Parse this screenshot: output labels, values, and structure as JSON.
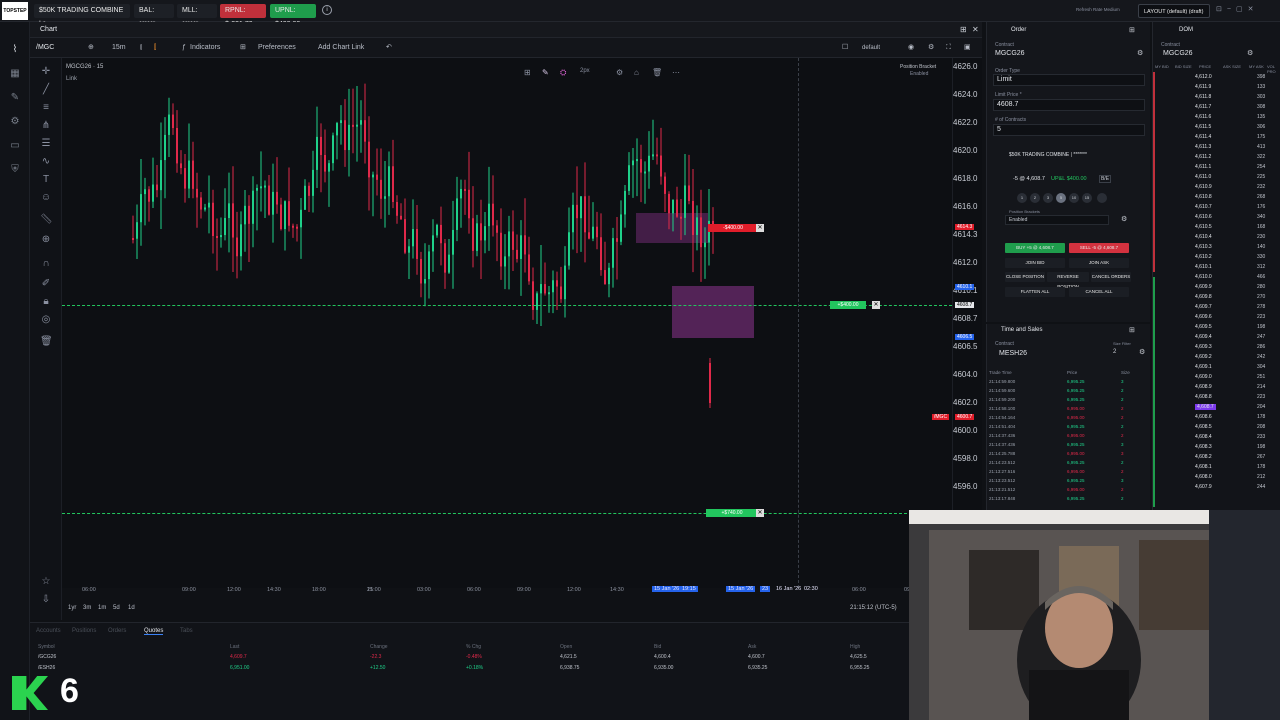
{
  "topbar": {
    "logo": "TOPSTEP",
    "account": "$50K TRADING COMBINE | *...",
    "bal": "BAL: ******",
    "mll": "MLL: ******",
    "rpnl": "RPNL: $-231.70",
    "upnl": "UPNL: $400.00",
    "user": "Refresh Rate Medium",
    "layout": "LAYOUT (default) (draft)"
  },
  "chart_panel": {
    "title": "Chart",
    "symbol": "/MGC",
    "timeframe": "15m",
    "indicators": "Indicators",
    "preferences": "Preferences",
    "add_link": "Add Chart Link",
    "default_label": "default",
    "series_title": "MGCG26 · 15",
    "link_label": "Link",
    "position_bracket": "Position Bracket",
    "position_bracket_state": "Enabled",
    "drawing_size": "2px"
  },
  "price_axis": [
    "4626.0",
    "4624.0",
    "4622.0",
    "4620.0",
    "4618.0",
    "4616.0",
    "4614.3",
    "4612.0",
    "4610.1",
    "4608.7",
    "4606.5",
    "4604.0",
    "4602.0",
    "4600.0",
    "4598.0",
    "4596.0"
  ],
  "price_tags": {
    "stop": "4614.3",
    "last": "4608.7",
    "entry": "4606.5",
    "mgc": "4600.7",
    "mgc_label": "/MGC",
    "upper": "4610.1"
  },
  "orders": {
    "stop_order": "-$400.00",
    "position": "+$400.00",
    "target": "+$740.00"
  },
  "time_axis": [
    "06:00",
    "09:00",
    "12:00",
    "14:30",
    "18:00",
    "21:00",
    "15",
    "03:00",
    "06:00",
    "09:00",
    "12:00",
    "14:30",
    "06:00",
    "09"
  ],
  "time_highlights": [
    "15 Jan '26",
    "19:15",
    "15 Jan '26",
    "23",
    "16 Jan '26",
    "02:30"
  ],
  "periods": [
    "1yr",
    "3m",
    "1m",
    "5d",
    "1d"
  ],
  "clock": "21:15:12 (UTC-5)",
  "quotes": {
    "tabs": [
      "Accounts",
      "Positions",
      "Orders",
      "Quotes",
      "Tabs"
    ],
    "active_tab": "Quotes",
    "headers": [
      "Symbol",
      "Last",
      "Change",
      "% Chg",
      "Open",
      "Bid",
      "Ask",
      "High"
    ],
    "rows": [
      [
        "/GCG26",
        "4,609.7",
        "-22.3",
        "-0.48%",
        "4,621.5",
        "4,600.4",
        "4,600.7",
        "4,625.5"
      ],
      [
        "/ESH26",
        "6,951.00",
        "+12.50",
        "+0.18%",
        "6,938.75",
        "6,935.00",
        "6,935.25",
        "6,955.25"
      ]
    ]
  },
  "order_panel": {
    "title": "Order",
    "contract_label": "Contract",
    "contract": "MGCG26",
    "order_type_label": "Order Type",
    "order_type": "Limit",
    "limit_price_label": "Limit Price *",
    "limit_price": "4608.7",
    "contracts_label": "# of Contracts",
    "contracts": "5",
    "account": "$50K TRADING COMBINE | *******",
    "position": "-5 @ 4,608.7",
    "upnl": "UP&L $400.00",
    "be": "B/E",
    "qty_buttons": [
      "1",
      "2",
      "3",
      "5",
      "10",
      "15"
    ],
    "bracket_label": "Position Brackets",
    "bracket_value": "Enabled",
    "buy": "BUY +5 @ 4,608.7",
    "sell": "SELL -5 @ 4,608.7",
    "join_bid": "JOIN BID",
    "join_ask": "JOIN ASK",
    "close_position": "CLOSE POSITION",
    "reverse_position": "REVERSE POSITION",
    "cancel_orders": "CANCEL ORDERS",
    "flatten_all": "FLATTEN ALL",
    "cancel_all": "CANCEL ALL"
  },
  "tas": {
    "title": "Time and Sales",
    "contract_label": "Contract",
    "contract": "MESH26",
    "size_filter": "2",
    "size_filter_label": "Size Filter",
    "headers": [
      "Trade Time",
      "Price",
      "Size"
    ],
    "rows": [
      [
        "21:14:59.800",
        "6,995.25",
        "3",
        "green"
      ],
      [
        "21:14:59.600",
        "6,995.25",
        "2",
        "green"
      ],
      [
        "21:14:59.200",
        "6,995.25",
        "2",
        "green"
      ],
      [
        "21:14:58.100",
        "6,995.00",
        "2",
        "red"
      ],
      [
        "21:14:54.164",
        "6,995.00",
        "2",
        "red"
      ],
      [
        "21:14:51.404",
        "6,995.25",
        "2",
        "green"
      ],
      [
        "21:14:37.436",
        "6,995.00",
        "2",
        "red"
      ],
      [
        "21:14:37.436",
        "6,995.25",
        "3",
        "green"
      ],
      [
        "21:14:25.788",
        "6,995.00",
        "3",
        "red"
      ],
      [
        "21:14:23.512",
        "6,995.25",
        "2",
        "green"
      ],
      [
        "21:13:27.516",
        "6,995.00",
        "2",
        "red"
      ],
      [
        "21:13:23.512",
        "6,995.25",
        "3",
        "green"
      ],
      [
        "21:13:21.512",
        "6,995.00",
        "2",
        "red"
      ],
      [
        "21:13:17.848",
        "6,995.25",
        "2",
        "green"
      ]
    ]
  },
  "dom": {
    "title": "DOM",
    "contract_label": "Contract",
    "contract": "MGCG26",
    "headers": [
      "MY BID",
      "BID SIZE",
      "PRICE",
      "ASK SIZE",
      "MY ASK",
      "VOL PRO"
    ],
    "rows": [
      [
        "4,612.0",
        "398"
      ],
      [
        "4,611.9",
        "133"
      ],
      [
        "4,611.8",
        "303"
      ],
      [
        "4,611.7",
        "308"
      ],
      [
        "4,611.6",
        "135"
      ],
      [
        "4,611.5",
        "306"
      ],
      [
        "4,611.4",
        "175"
      ],
      [
        "4,611.3",
        "413"
      ],
      [
        "4,611.2",
        "322"
      ],
      [
        "4,611.1",
        "254"
      ],
      [
        "4,611.0",
        "225"
      ],
      [
        "4,610.9",
        "232"
      ],
      [
        "4,610.8",
        "268"
      ],
      [
        "4,610.7",
        "176"
      ],
      [
        "4,610.6",
        "340"
      ],
      [
        "4,610.5",
        "168"
      ],
      [
        "4,610.4",
        "230"
      ],
      [
        "4,610.3",
        "140"
      ],
      [
        "4,610.2",
        "330"
      ],
      [
        "4,610.1",
        "312"
      ],
      [
        "4,610.0",
        "466"
      ],
      [
        "4,609.9",
        "280"
      ],
      [
        "4,609.8",
        "270"
      ],
      [
        "4,609.7",
        "278"
      ],
      [
        "4,609.6",
        "223"
      ],
      [
        "4,609.5",
        "198"
      ],
      [
        "4,609.4",
        "247"
      ],
      [
        "4,609.3",
        "286"
      ],
      [
        "4,609.2",
        "242"
      ],
      [
        "4,609.1",
        "304"
      ],
      [
        "4,609.0",
        "251"
      ],
      [
        "4,608.9",
        "214"
      ],
      [
        "4,608.8",
        "223"
      ],
      [
        "4,608.7",
        "204"
      ],
      [
        "4,608.6",
        "178"
      ],
      [
        "4,608.5",
        "208"
      ],
      [
        "4,608.4",
        "233"
      ],
      [
        "4,608.3",
        "198"
      ],
      [
        "4,608.2",
        "267"
      ],
      [
        "4,608.1",
        "178"
      ],
      [
        "4,608.0",
        "212"
      ],
      [
        "4,607.9",
        "244"
      ]
    ],
    "highlight_price": "4,608.7"
  },
  "overlay": {
    "k_digit": "6"
  },
  "colors": {
    "up": "#1fd18a",
    "down": "#e0294a",
    "accent": "#3b82f6",
    "buy": "#1faa4c",
    "sell": "#d8323f"
  }
}
